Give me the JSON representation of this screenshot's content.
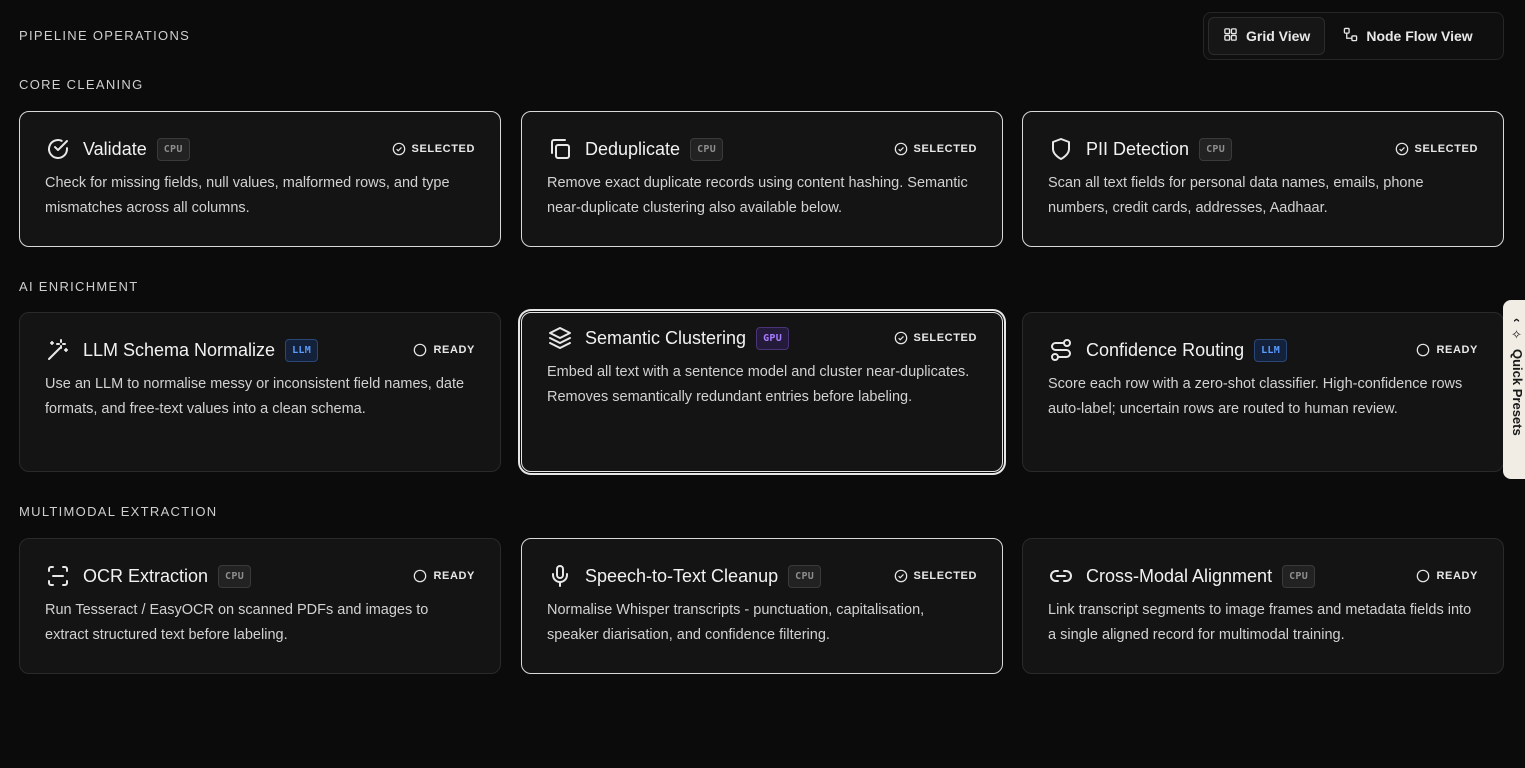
{
  "header": {
    "title": "PIPELINE OPERATIONS"
  },
  "view_toggle": {
    "grid_label": "Grid View",
    "node_label": "Node Flow View",
    "active": "grid"
  },
  "side_tab": {
    "label": "Quick Presets"
  },
  "sections": [
    {
      "label": "CORE CLEANING",
      "cards": [
        {
          "title": "Validate",
          "tag": "CPU",
          "status": "SELECTED",
          "icon": "check-circle-icon",
          "desc": "Check for missing fields, null values, malformed rows, and type mismatches across all columns."
        },
        {
          "title": "Deduplicate",
          "tag": "CPU",
          "status": "SELECTED",
          "icon": "copy-icon",
          "desc": "Remove exact duplicate records using content hashing. Semantic near-duplicate clustering also available below."
        },
        {
          "title": "PII Detection",
          "tag": "CPU",
          "status": "SELECTED",
          "icon": "shield-icon",
          "desc": "Scan all text fields for personal data names, emails, phone numbers, credit cards, addresses, Aadhaar."
        }
      ]
    },
    {
      "label": "AI ENRICHMENT",
      "cards": [
        {
          "title": "LLM Schema Normalize",
          "tag": "LLM",
          "status": "READY",
          "icon": "magic-wand-icon",
          "desc": "Use an LLM to normalise messy or inconsistent field names, date formats, and free-text values into a clean schema."
        },
        {
          "title": "Semantic Clustering",
          "tag": "GPU",
          "status": "SELECTED",
          "icon": "layers-icon",
          "desc": "Embed all text with a sentence model and cluster near-duplicates. Removes semantically redundant entries before labeling."
        },
        {
          "title": "Confidence Routing",
          "tag": "LLM",
          "status": "READY",
          "icon": "route-icon",
          "desc": "Score each row with a zero-shot classifier. High-confidence rows auto-label; uncertain rows are routed to human review."
        }
      ]
    },
    {
      "label": "MULTIMODAL EXTRACTION",
      "cards": [
        {
          "title": "OCR Extraction",
          "tag": "CPU",
          "status": "READY",
          "icon": "scan-icon",
          "desc": "Run Tesseract / EasyOCR on scanned PDFs and images to extract structured text before labeling."
        },
        {
          "title": "Speech-to-Text Cleanup",
          "tag": "CPU",
          "status": "SELECTED",
          "icon": "mic-icon",
          "desc": "Normalise Whisper transcripts - punctuation, capitalisation, speaker diarisation, and confidence filtering."
        },
        {
          "title": "Cross-Modal Alignment",
          "tag": "CPU",
          "status": "READY",
          "icon": "link-icon",
          "desc": "Link transcript segments to image frames and metadata fields into a single aligned record for multimodal training."
        }
      ]
    }
  ]
}
